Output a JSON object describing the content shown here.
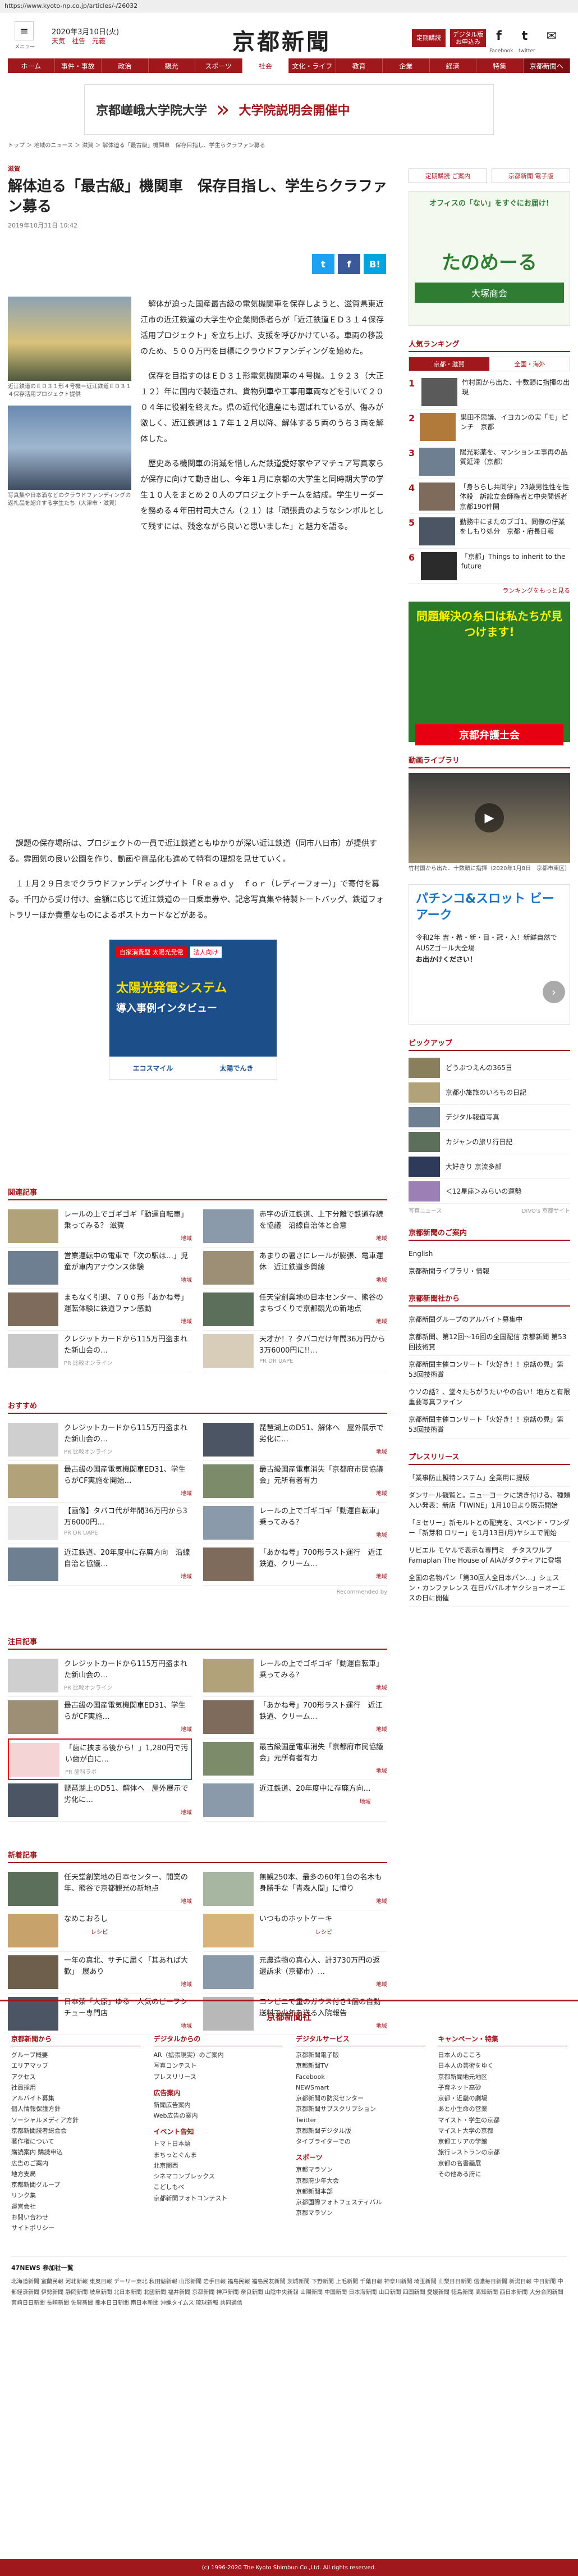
{
  "url": "https://www.kyoto-np.co.jp/articles/-/26032",
  "header": {
    "menu_label": "メニュー",
    "date": "2020年3月10日(火)",
    "weather": "天気　社告　元義",
    "brand": "京都新聞",
    "btn1": "定期購読",
    "btn2": "デジタル版お申込み",
    "twitter": "twitter",
    "facebook": "Facebook",
    "twitter_label": "twitter"
  },
  "nav": [
    "ホーム",
    "事件・事故",
    "政治",
    "観光",
    "スポーツ",
    "社会",
    "文化・ライフ",
    "教育",
    "企業",
    "経済",
    "特集",
    "京都新聞ヘ"
  ],
  "ad_top": {
    "text1": "京都嵯峨大学院大学",
    "text2": "大学院説明会開催中"
  },
  "breadcrumb": "トップ ＞ 地域のニュース ＞ 滋賀 ＞ 解体迫る「最古級」機関車　保存目指し、学生らクラファン募る",
  "article": {
    "category": "滋賀",
    "title": "解体迫る「最古級」機関車　保存目指し、学生らクラファン募る",
    "date": "2019年10月31日 10:42",
    "photo1_caption": "近江鉄道のＥＤ３１形４号機＝近江鉄道ＥＤ３１４保存活用プロジェクト提供",
    "photo2_caption": "写真集や日本酒などのクラウドファンディングの返礼品を紹介する学生たち（大津市・滋賀）",
    "paragraphs": [
      "解体が迫った国産最古級の電気機関車を保存しようと、滋賀県東近江市の近江鉄道の大学生や企業関係者らが「近江鉄道ＥＤ３１４保存活用プロジェクト」を立ち上げ、支援を呼びかけている。車両の移設のため、５００万円を目標にクラウドファンディングを始めた。",
      "保存を目指すのはＥＤ３１形電気機関車の４号機。１９２３（大正１２）年に国内で製造され、貨物列車や工事用車両などを引いて２００４年に役割を終えた。県の近代化遺産にも選ばれているが、傷みが激しく、近江鉄道は１７年１２月以降、解体する５両のうち３両を解体した。",
      "歴史ある機関車の消滅を惜しんだ鉄道愛好家やアマチュア写真家らが保存に向けて動き出し、今年１月に京都の大学生と同時期大学の学生１０人をまとめ２０人のプロジェクトチームを結成。学生リーダーを務める４年田村司大さん（２１）は「頑張貴のようなシンボルとして残すには、残念ながら良いと思いました」と魅力を語る。",
      "課題の保存場所は、プロジェクトの一員で近江鉄道ともゆかりが深い近江鉄道（同市八日市）が提供する。雰囲気の良い公園を作り、動画や商品化も進めて特有の理想を見せていく。",
      "１１月２９日までクラウドファンディングサイト「Ｒｅａｄｙ　ｆｏｒ（レディーフォー）」で寄付を募る。千円から受け付け、金額に応じて近江鉄道の一日乗車券や、記念写真集や特製トートバッグ、鉄道フォトラリーほか貴重なものによるポストカードなどがある。"
    ]
  },
  "ad_mid": {
    "tag1": "自家消費型 太陽光発電",
    "tag2": "法人向け",
    "text1": "太陽光発電システム",
    "text2": "導入事例インタビュー",
    "brand1": "エコスマイル",
    "brand2": "太陽でんき"
  },
  "related": {
    "title": "関連記事",
    "items": [
      {
        "text": "レールの上でゴギゴギ「動運自転車」乗ってみる？ 滋賀",
        "tag": "地域"
      },
      {
        "text": "赤字の近江鉄道、上下分離で鉄道存続を協議　沿線自治体と合意",
        "tag": "地域"
      },
      {
        "text": "営業運転中の電車で「次の駅は…」児童が車内アナウンス体験",
        "tag": "地域"
      },
      {
        "text": "あまりの暑さにレールが膨張、電車運休　近江鉄道多賀線",
        "tag": "地域"
      },
      {
        "text": "まもなく引退、７００形「あかね号」運転体験に鉄道ファン感動",
        "tag": "地域"
      },
      {
        "text": "任天堂創業地の日本センター、熊谷のまちづくりで京都観光の新地点",
        "tag": "地域"
      },
      {
        "text": "クレジットカードから115万円盗まれた新山会の…",
        "tag": "PR 比較オンライン"
      },
      {
        "text": "天才か！？タバコだけ年間36万円から3万6000円に!!…",
        "tag": "PR DR UAPE"
      }
    ]
  },
  "recommend": {
    "title": "おすすめ",
    "items": [
      {
        "text": "クレジットカードから115万円盗まれた新山会の…",
        "tag": "PR 比較オンライン"
      },
      {
        "text": "琵琶湖上のD51、解体へ　屋外展示で劣化に…",
        "tag": "地域"
      },
      {
        "text": "最古級の国産電気機関車ED31、学生らがCF実施を開始…",
        "tag": "地域"
      },
      {
        "text": "最古級国産電車消失「京都府市民協議会」元所有者有力",
        "tag": "地域"
      },
      {
        "text": "【画像】タバコ代が年間36万円から3万6000円…",
        "tag": "PR DR UAPE"
      },
      {
        "text": "レールの上でゴギゴギ「動運自転車」乗ってみる？",
        "tag": "地域"
      },
      {
        "text": "近江鉄道、20年度中に存廃方向　沿線自治と協議…",
        "tag": "地域"
      },
      {
        "text": "「あかね号」700形ラスト運行　近江鉄道、クリーム…",
        "tag": "地域"
      }
    ],
    "powered": "Recommended by"
  },
  "featured": {
    "title": "注目記事",
    "items": [
      {
        "text": "クレジットカードから115万円盗まれた新山会の…",
        "tag": "PR 比較オンライン"
      },
      {
        "text": "レールの上でゴギゴギ「動運自転車」乗ってみる？",
        "tag": "地域"
      },
      {
        "text": "最古級の国産電気機関車ED31、学生らがCF実施…",
        "tag": "地域"
      },
      {
        "text": "「あかね号」700形ラスト運行　近江鉄道、クリーム…",
        "tag": "地域"
      },
      {
        "text": "「歯に挟まる後から！」1,280円で汚い歯が白に…",
        "tag": "PR 歯科ラボ"
      },
      {
        "text": "最古級国産電車消失「京都府市民協議会」元所有者有力",
        "tag": "地域"
      },
      {
        "text": "琵琶湖上のD51、解体へ　屋外展示で劣化に…",
        "tag": "地域"
      },
      {
        "text": "近江鉄道、20年度中に存廃方向…",
        "tag": "地域"
      }
    ]
  },
  "newest": {
    "title": "新着記事",
    "items": [
      {
        "text": "任天堂創業地の日本センター、開業の年、熊谷で京都観光の新地点",
        "tag": "地域"
      },
      {
        "text": "無観250本、最多の60年1台の名木も　身勝手な「青森人間」に憤り",
        "tag": "地域"
      },
      {
        "text": "なめこおろし",
        "tag": "レシピ"
      },
      {
        "text": "いつものホットケーキ",
        "tag": "レシピ"
      },
      {
        "text": "一年の真北、サチに届く「其あれば大歓」　展あり",
        "tag": "地域"
      },
      {
        "text": "元農造物の真心人、計3730万円の返還訴求（京都市）…",
        "tag": "地域"
      },
      {
        "text": "日本茶「大原」ゆる　人気のビーフシチュー専門店",
        "tag": "地域"
      },
      {
        "text": "コンビニで重のガウス付き1個の自動送料で少年を送る入院報告",
        "tag": "地域"
      }
    ]
  },
  "side": {
    "btn1": "定期購読 ご案内",
    "btn2": "京都新聞 電子版",
    "ad1": {
      "t1": "オフィスの「ない」をすぐにお届け!",
      "t2": "たのめーる",
      "t3": "大塚商会"
    },
    "ranking_title": "人気ランキング",
    "rank_tabs": [
      "京都・滋賀",
      "全国・海外"
    ],
    "ranking": [
      "竹村国から出た、十数頭に指揮の出現",
      "巣田不思議、イヨカンの実「モ」ピンチ　京都",
      "陽光彩薬を、マンションエ事再の品質延滞（京都）",
      "「身ちらし共同学」23歳男性性を性体殺　訴訟立会師権者と中央関係者　京都190件開",
      "勤務中にまたのブゴ1、同僚の仔業をしもり処分　京都・府長日報",
      "「京都」Things to inherit to the future"
    ],
    "more_ranking": "ランキングをもっと見る",
    "ad2": {
      "t1": "問題解決の糸口は私たちが見つけます!",
      "t2": "京都弁護士会"
    },
    "video_title": "動画ライブラリ",
    "video_caption": "竹村国から出た、十数頭に指揮（2020年1月8日　京都市東区）",
    "ad3": {
      "t1": "パチンコ&スロット ビーアーク",
      "t2": "令和2年 吉・希・新・目・冠・入！新鮮自然でAUSZゴール大全場",
      "t3": "お出かけください！"
    },
    "pickup_title": "ピックアップ",
    "pickup": [
      "どうぶつえんの365日",
      "京都小旅旅のいろもの日記",
      "デジタル報道写真",
      "カジャンの旅リ行日記",
      "大好きり 京流多部",
      "＜12星座＞みらいの運勢"
    ],
    "photo_more": "写真ニュース",
    "powered": "DIVO's 京都サイト",
    "guide_title": "京都新聞のご案内",
    "guide": [
      "English",
      "京都新聞ライブラリ・情報"
    ],
    "notice_title": "京都新聞社から",
    "notices": [
      "京都新聞グループのアルバイト募集中",
      "京都新聞、第12回〜16回の全国配信 京都新聞 第53回技術賞",
      "京都新聞主催コンサート「火好き！！京話の見」第53回技術賞",
      "ウソの話？、堂々たちがうたいやの合い！地方と有限 重要写真ファイン",
      "京都新聞主催コンサート「火好き！！京話の見」第53回技術賞"
    ],
    "press_title": "プレスリリース",
    "press": [
      "「業事防止擬特ンステム」全業用に提販",
      "ダンサール観覧と。ニューヨークに誘き付ける、種類入い発表：新店「TWINE」1月10日より販売開始",
      "「ミセリー」新モルトとの配売を、スペンド・ワンダー「新芽和 ロリー」を1月13日(月)ヤシエで開始",
      "リビエル モヤルで表示な専門ミ　チタスワルプFamaplan The House of AIAがダクティアに登場",
      "全国の名物パン「第30回人全日本パン…」シェスン・カンファレンス 在日パバルオヤクショーオーエスの日に開催"
    ]
  },
  "company_logo": "京都新聞社",
  "footer": {
    "cols": [
      {
        "h": "京都新聞から",
        "items": [
          "グループ概要",
          "エリアマップ",
          "アクセス",
          "社員採用",
          "アルバイト募集",
          "個人情報保護方針",
          "ソーシャルメディア方針",
          "京都新聞読者総会会",
          "著作権について",
          "購読案内 購読申込",
          "広告のご案内",
          "地方支局",
          "京都新聞グループ",
          "リンク集",
          "運営会社",
          "お問い合わせ",
          "サイトポリシー"
        ]
      },
      {
        "h": "デジタルからの",
        "items": [
          "AR（拡張現実）のご案内",
          "写真コンテスト",
          "プレスリリース"
        ],
        "h2": "広告案内",
        "items2": [
          "新聞広告案内",
          "Web広告の案内"
        ],
        "h3": "イベント告知",
        "items3": [
          "トマト日本語",
          "まちっとぐんま",
          "北京関西",
          "シネマコンプレックス",
          "こどしもべ",
          "京都新聞フォトコンテスト"
        ]
      },
      {
        "h": "デジタルサービス",
        "items": [
          "京都新聞電子版",
          "京都新聞TV",
          "Facebook",
          "NEWSmart",
          "京都新聞の防災センター",
          "京都新聞サブスクリプション",
          "Twitter",
          "京都新聞デジタル版",
          "タイプライターでの"
        ],
        "h2": "スポーツ",
        "items2": [
          "京都マラソン",
          "京都府少年大会",
          "京都新聞本部",
          "京都国際フォトフェスティバル",
          "京都マラソン"
        ]
      },
      {
        "h": "キャンペーン・特集",
        "items": [
          "日本人のこころ",
          "日本人の芸術をゆく",
          "京都新聞地元地区",
          "子育ネット高砂",
          "京都・近畿の劇場",
          "あと小生命の営業",
          "マイスト・学生の京都",
          "マイスト大学の京都",
          "京都エリアの学館",
          "旅行レストランの京都",
          "京都の名書画展",
          "その他ある府に"
        ]
      }
    ],
    "prefs_label": "47NEWS 参加社一覧",
    "prefs": "北海道新聞 室蘭民報 河北新報 東奥日報 デーリー東北 秋田魁新報 山形新聞 岩手日報 福島民報 福島民友新聞 茨城新聞 下野新聞 上毛新聞 千葉日報 神奈川新聞 埼玉新聞 山梨日日新聞 信濃毎日新聞 新潟日報 中日新聞 中部経済新聞 伊勢新聞 静岡新聞 岐阜新聞 北日本新聞 北國新聞 福井新聞 京都新聞 神戸新聞 奈良新聞 山陰中央新報 山陽新聞 中国新聞 日本海新聞 山口新聞 四国新聞 愛媛新聞 徳島新聞 高知新聞 西日本新聞 大分合同新聞 宮崎日日新聞 長崎新聞 佐賀新聞 熊本日日新聞 南日本新聞 沖縄タイムス 琉球新報 共同通信",
    "copyright": "(c) 1996-2020 The Kyoto Shimbun Co.,Ltd. All rights reserved."
  }
}
